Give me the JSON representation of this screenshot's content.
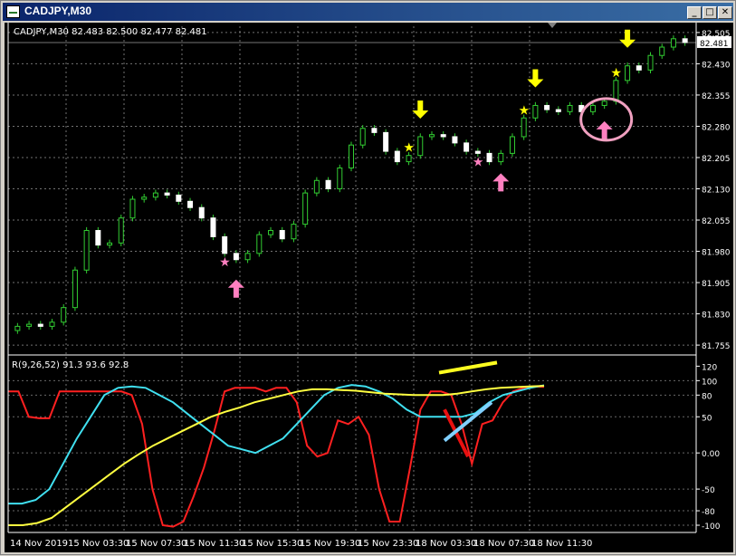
{
  "window": {
    "title": "CADJPY,M30",
    "buttons": {
      "minimize": "_",
      "maximize": "□",
      "close": "✕"
    }
  },
  "chart_data": [
    {
      "type": "candlestick",
      "header": "CADJPY,M30  82.483 82.500 82.477 82.481",
      "price_tag": "82.481",
      "current_price": 82.481,
      "ylim": [
        81.74,
        82.52
      ],
      "yticks": [
        82.505,
        82.43,
        82.355,
        82.28,
        82.205,
        82.13,
        82.055,
        81.98,
        81.905,
        81.83,
        81.755
      ],
      "ytick_labels": [
        "82.505",
        "82.430",
        "82.355",
        "82.280",
        "82.205",
        "82.130",
        "82.055",
        "81.980",
        "81.905",
        "81.830",
        "81.755"
      ],
      "grid": true,
      "colors": {
        "bull": "#32cd32",
        "bear": "#ffffff",
        "grid": "#cfcfcf",
        "up_arrow": "#ff80c0",
        "down_arrow": "#ffff00"
      },
      "close_series": [
        81.8,
        81.805,
        81.8,
        81.81,
        81.845,
        81.935,
        82.03,
        81.995,
        82.0,
        82.06,
        82.105,
        82.11,
        82.12,
        82.115,
        82.1,
        82.085,
        82.06,
        82.015,
        81.975,
        81.96,
        81.975,
        82.02,
        82.03,
        82.01,
        82.045,
        82.12,
        82.15,
        82.13,
        82.18,
        82.235,
        82.275,
        82.265,
        82.22,
        82.195,
        82.21,
        82.255,
        82.26,
        82.255,
        82.24,
        82.22,
        82.215,
        82.195,
        82.215,
        82.255,
        82.3,
        82.33,
        82.32,
        82.315,
        82.33,
        82.315,
        82.33,
        82.34,
        82.39,
        82.425,
        82.415,
        82.45,
        82.47,
        82.49,
        82.481
      ],
      "signals": [
        {
          "type": "buy-arrow",
          "index": 19
        },
        {
          "type": "buy-star",
          "index": 18
        },
        {
          "type": "sell-star",
          "index": 34
        },
        {
          "type": "sell-arrow",
          "index": 35
        },
        {
          "type": "buy-star",
          "index": 40
        },
        {
          "type": "buy-arrow",
          "index": 42
        },
        {
          "type": "sell-star",
          "index": 44
        },
        {
          "type": "sell-arrow",
          "index": 45
        },
        {
          "type": "buy-arrow",
          "index": 51
        },
        {
          "type": "sell-star",
          "index": 52
        },
        {
          "type": "sell-arrow",
          "index": 53
        }
      ]
    },
    {
      "type": "line",
      "header": "R(9,26,52) 91.3 93.6 92.8",
      "ylim": [
        -110,
        128
      ],
      "yticks": [
        120,
        100,
        80,
        50,
        0.0,
        -50,
        -80,
        -100
      ],
      "ytick_labels": [
        "120",
        "100",
        "80",
        "50",
        "0.00",
        "-50",
        "-80",
        "-100"
      ],
      "grid": true,
      "series": [
        {
          "color": "#ff2020",
          "values": [
            85,
            85,
            50,
            48,
            48,
            85,
            85,
            85,
            85,
            85,
            85,
            85,
            80,
            40,
            -50,
            -100,
            -102,
            -95,
            -60,
            -20,
            30,
            85,
            90,
            90,
            90,
            85,
            90,
            90,
            70,
            10,
            -5,
            0,
            45,
            40,
            50,
            25,
            -50,
            -95,
            -95,
            -20,
            60,
            85,
            85,
            80,
            40,
            -15,
            40,
            45,
            70,
            85,
            90,
            92,
            91.3
          ]
        },
        {
          "color": "#40e0f0",
          "values": [
            -70,
            -70,
            -65,
            -50,
            -15,
            20,
            50,
            80,
            90,
            92,
            90,
            80,
            70,
            55,
            40,
            25,
            10,
            5,
            0,
            10,
            20,
            40,
            60,
            80,
            90,
            94,
            92,
            85,
            75,
            60,
            50,
            50,
            50,
            50,
            55,
            70,
            80,
            85,
            90,
            93.6
          ]
        },
        {
          "color": "#ffff40",
          "values": [
            -100,
            -100,
            -97,
            -90,
            -75,
            -60,
            -45,
            -30,
            -15,
            -2,
            10,
            20,
            30,
            40,
            50,
            57,
            63,
            70,
            75,
            80,
            85,
            88,
            88,
            87,
            86,
            84,
            82,
            81,
            80,
            80,
            80,
            82,
            85,
            88,
            90,
            91,
            92,
            92.8
          ]
        }
      ]
    }
  ],
  "x_axis": {
    "tick_labels": [
      "14 Nov 2019",
      "15 Nov 03:30",
      "15 Nov 07:30",
      "15 Nov 11:30",
      "15 Nov 15:30",
      "15 Nov 19:30",
      "15 Nov 23:30",
      "18 Nov 03:30",
      "18 Nov 07:30",
      "18 Nov 11:30"
    ]
  },
  "annotations": {
    "ellipse_color": "#f0a0c0",
    "trendlines": [
      {
        "color": "#ffff20",
        "pane": "indicator"
      },
      {
        "color": "#e81010",
        "pane": "indicator"
      },
      {
        "color": "#80d0ff",
        "pane": "indicator"
      }
    ]
  }
}
